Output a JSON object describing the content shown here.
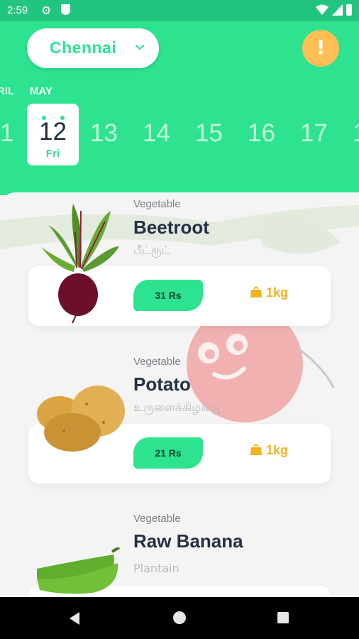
{
  "status": {
    "time": "2:59",
    "icons": [
      "settings-gear-icon",
      "shield-icon",
      "wifi-icon",
      "signal-icon",
      "battery-icon"
    ]
  },
  "header": {
    "city": "Chennai",
    "alert_icon": "!",
    "months": {
      "previous": "RIL",
      "current": "MAY"
    },
    "selected": {
      "day_num": "12",
      "weekday": "Fri"
    },
    "dates": [
      "1",
      "13",
      "14",
      "15",
      "16",
      "17",
      "1"
    ]
  },
  "products": [
    {
      "category": "Vegetable",
      "name": "Beetroot",
      "local_name": "பீட்ரூட்",
      "price": "31 Rs",
      "quantity": "1kg",
      "image": "beetroot"
    },
    {
      "category": "Vegetable",
      "name": "Potato",
      "local_name": "உருளைக்கிழங்கு",
      "price": "21 Rs",
      "quantity": "1kg",
      "image": "potato"
    },
    {
      "category": "Vegetable",
      "name": "Raw Banana",
      "local_name": "Plantain",
      "image": "raw-banana"
    }
  ],
  "colors": {
    "primary": "#2de390",
    "status_bar": "#21c57f",
    "alert": "#ffbf55",
    "weight": "#f2b21b",
    "mascot": "#f07a7a"
  }
}
